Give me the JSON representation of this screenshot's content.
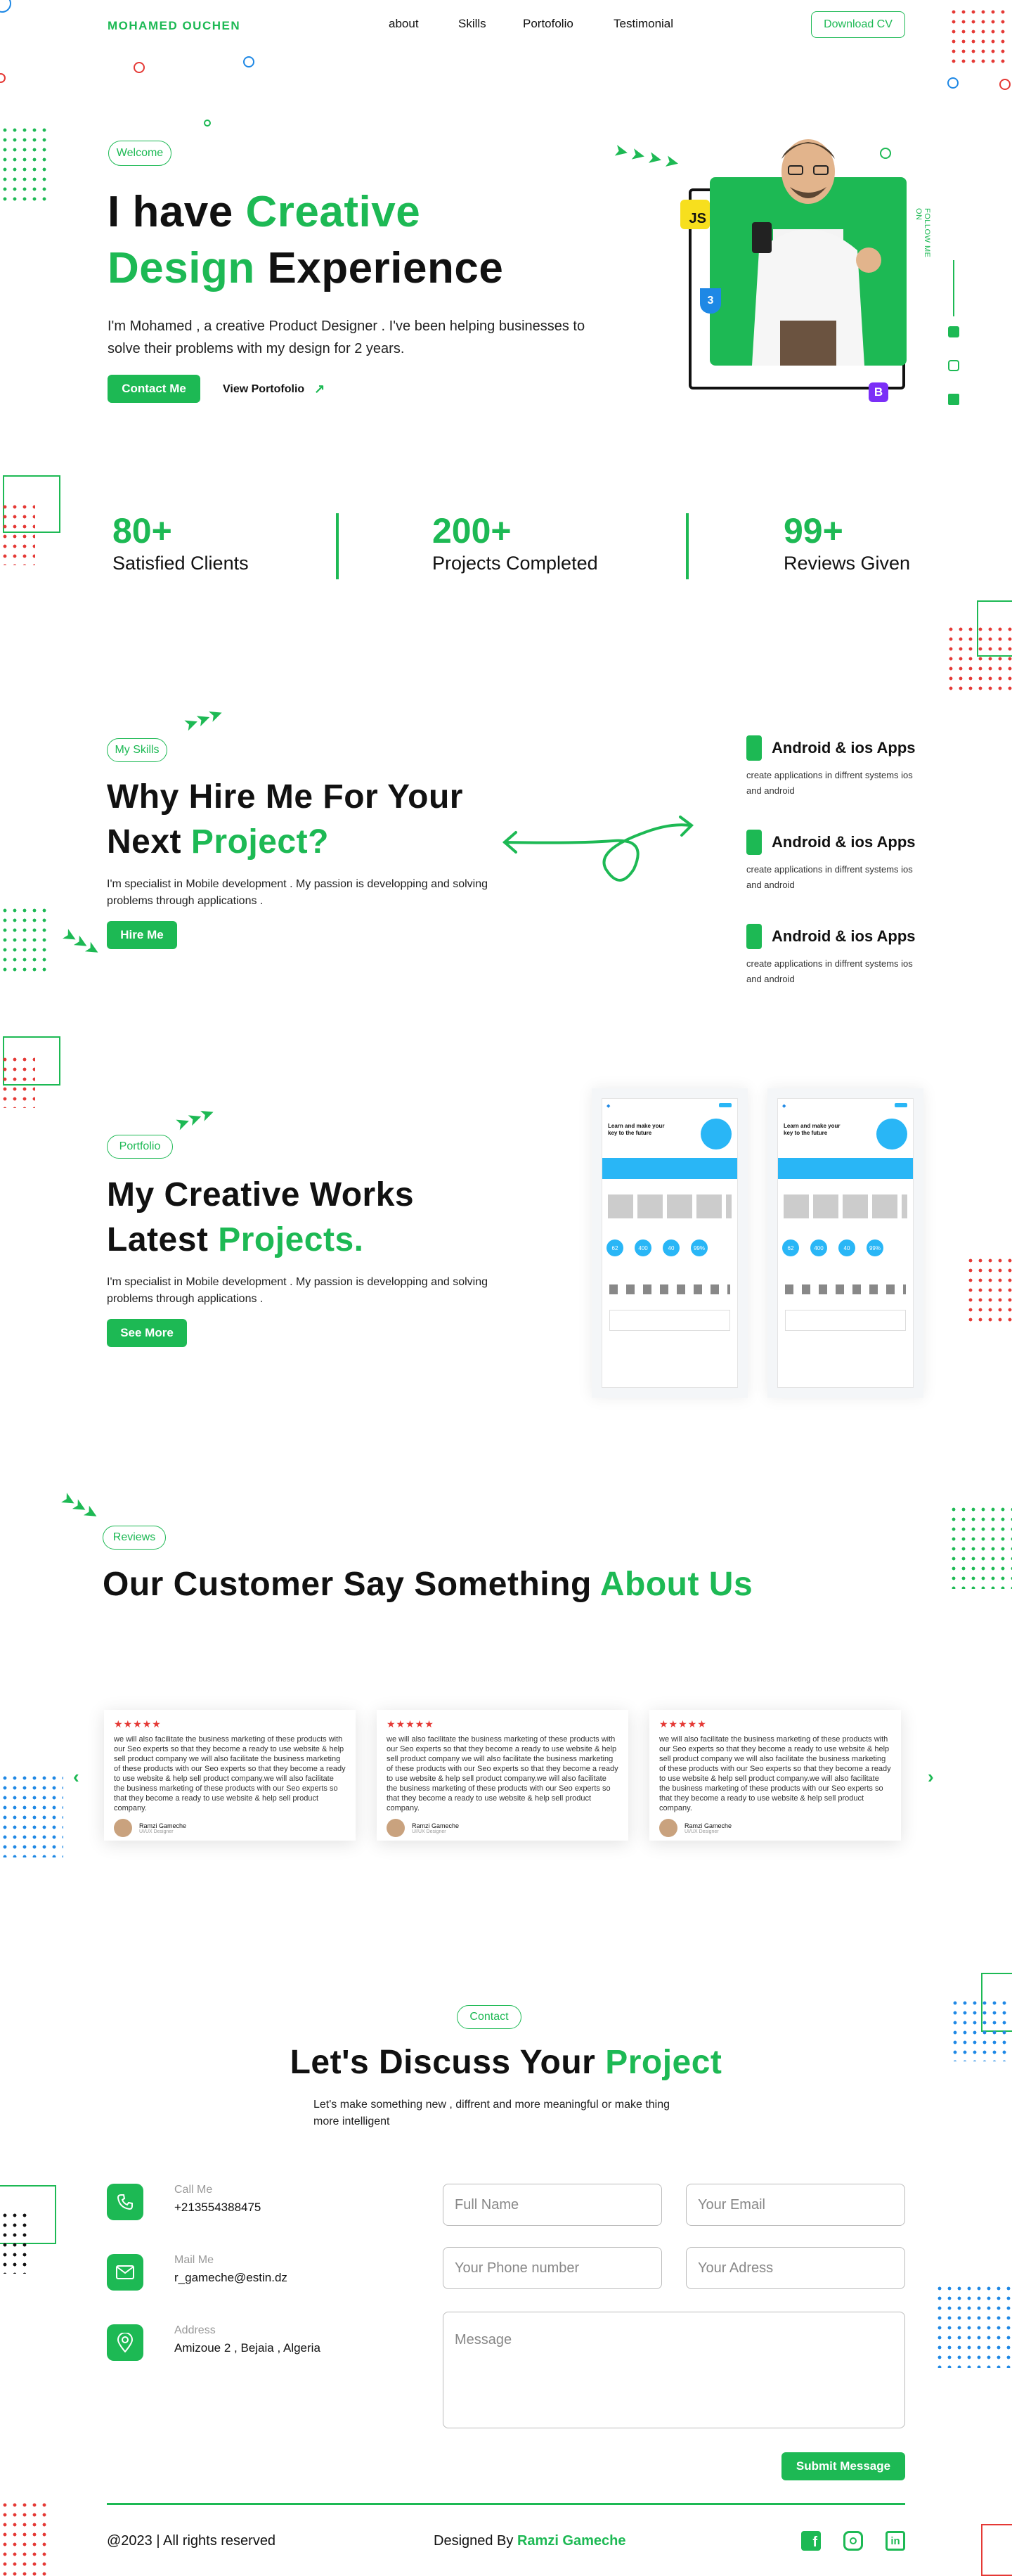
{
  "brand": "MOHAMED OUCHEN",
  "nav": {
    "items": [
      "about",
      "Skills",
      "Portofolio",
      "Testimonial"
    ],
    "cta": "Download CV"
  },
  "hero": {
    "badge": "Welcome",
    "line1_a": "I have ",
    "line1_b": "Creative",
    "line2_a": "Design",
    "line2_b": " Experience",
    "desc": "I'm Mohamed , a creative Product Designer . I've been helping businesses to solve their problems with my design for 2 years.",
    "contact": "Contact Me",
    "portfolio": "View Portofolio",
    "follow": "FOLLOW ME ON",
    "js_badge": "JS",
    "css_badge": "3",
    "bs_badge": "B"
  },
  "stats": [
    {
      "num": "80+",
      "label": "Satisfied Clients"
    },
    {
      "num": "200+",
      "label": "Projects Completed"
    },
    {
      "num": "99+",
      "label": "Reviews Given"
    }
  ],
  "skills": {
    "badge": "My Skills",
    "title_a": "Why Hire Me For Your",
    "title_b": "Next ",
    "title_c": "Project?",
    "desc": "I'm specialist in Mobile development . My passion is developping and solving problems through applications .",
    "cta": "Hire Me",
    "items": [
      {
        "title": "Android & ios Apps",
        "desc": "create applications in diffrent systems ios and android"
      },
      {
        "title": "Android & ios Apps",
        "desc": "create applications in diffrent systems ios and android"
      },
      {
        "title": "Android & ios Apps",
        "desc": "create applications in diffrent systems ios and android"
      }
    ]
  },
  "portfolio": {
    "badge": "Portfolio",
    "title_a": "My Creative Works",
    "title_b": "Latest ",
    "title_c": "Projects.",
    "desc": "I'm specialist in Mobile development . My passion is developping and solving problems through applications .",
    "cta": "See More",
    "mock_heading": "Learn and make your key to the future",
    "mock_stats": [
      "62",
      "400",
      "40",
      "99%"
    ]
  },
  "reviews": {
    "badge": "Reviews",
    "title_a": "Our Customer Say Something ",
    "title_b": "About Us",
    "stars": "★★★★★",
    "items": [
      {
        "text": "we will also facilitate the business marketing of these products with our Seo experts so that they become a ready to use website & help sell product company we will also facilitate the business marketing of these products with our Seo experts so that they become a ready to use website & help sell product company.we will also facilitate the business marketing of these products with our Seo experts so that they become a ready to use website & help sell product company.",
        "name": "Ramzi Gameche",
        "role": "UI/UX Designer"
      },
      {
        "text": "we will also facilitate the business marketing of these products with our Seo experts so that they become a ready to use website & help sell product company we will also facilitate the business marketing of these products with our Seo experts so that they become a ready to use website & help sell product company.we will also facilitate the business marketing of these products with our Seo experts so that they become a ready to use website & help sell product company.",
        "name": "Ramzi Gameche",
        "role": "UI/UX Designer"
      },
      {
        "text": "we will also facilitate the business marketing of these products with our Seo experts so that they become a ready to use website & help sell product company we will also facilitate the business marketing of these products with our Seo experts so that they become a ready to use website & help sell product company.we will also facilitate the business marketing of these products with our Seo experts so that they become a ready to use website & help sell product company.",
        "name": "Ramzi Gameche",
        "role": "UI/UX Designer"
      }
    ]
  },
  "contact": {
    "badge": "Contact",
    "title_a": "Let's Discuss Your ",
    "title_b": "Project",
    "desc": "Let's make something new , diffrent and more meaningful or make thing more intelligent",
    "call_label": "Call Me",
    "call_value": "+213554388475",
    "mail_label": "Mail Me",
    "mail_value": "r_gameche@estin.dz",
    "addr_label": "Address",
    "addr_value": "Amizoue 2 , Bejaia , Algeria",
    "ph_name": "Full Name",
    "ph_email": "Your Email",
    "ph_phone": "Your Phone number",
    "ph_addr": "Your Adress",
    "ph_msg": "Message",
    "submit": "Submit Message"
  },
  "footer": {
    "copy": "@2023 | All rights reserved",
    "designed": "Designed By ",
    "designer": "Ramzi Gameche"
  },
  "colors": {
    "accent": "#1db954",
    "dots_red": "#e53935",
    "dots_blue": "#1e88e5"
  }
}
